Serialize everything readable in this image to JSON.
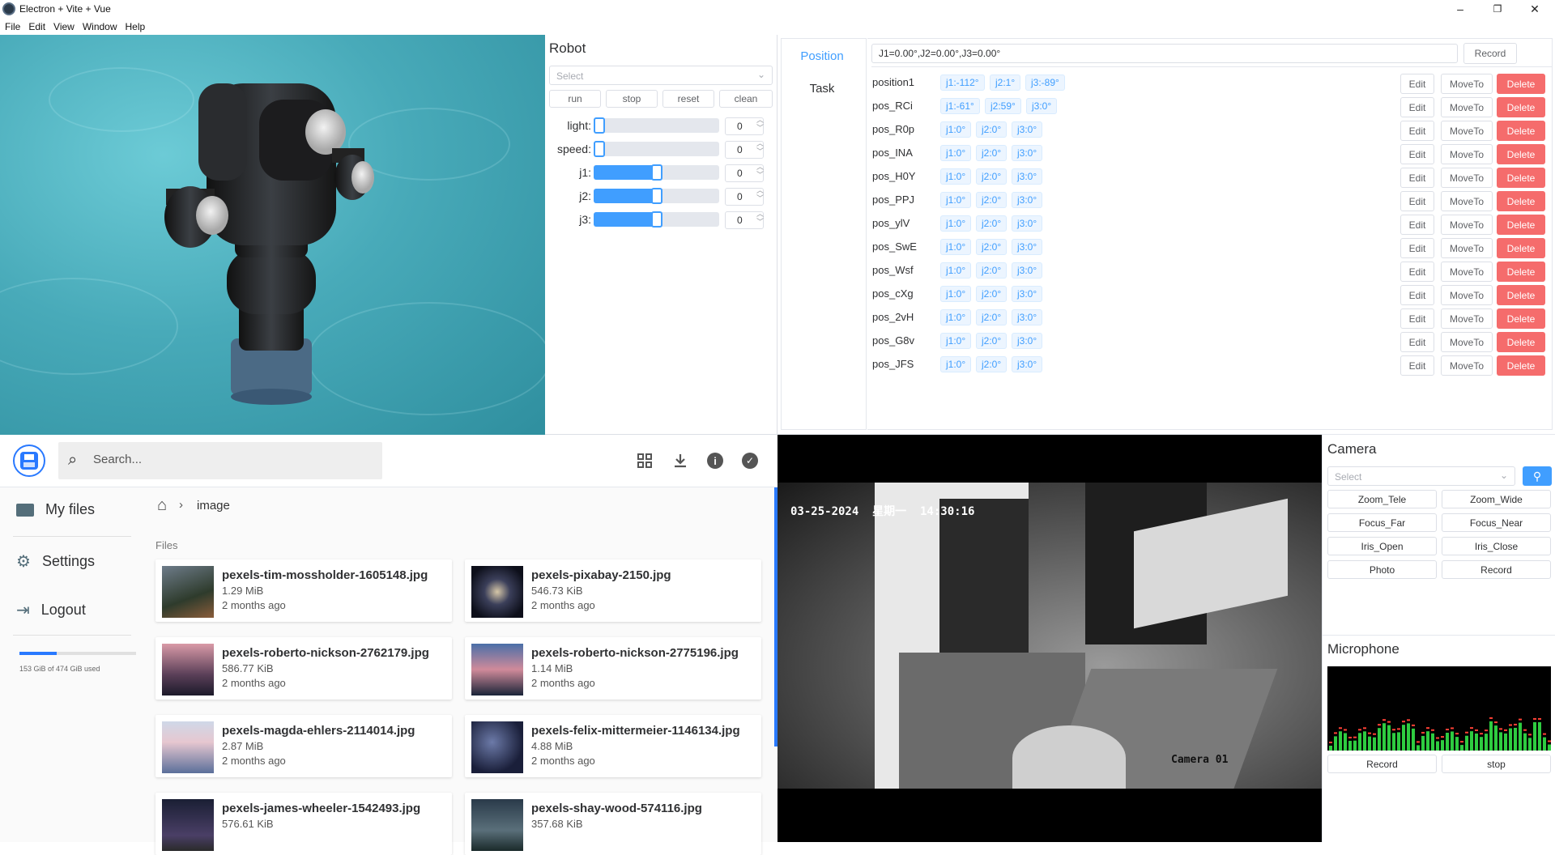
{
  "window": {
    "title": "Electron + Vite + Vue",
    "minimize": "–",
    "maximize": "❐",
    "close": "✕"
  },
  "menu": [
    "File",
    "Edit",
    "View",
    "Window",
    "Help"
  ],
  "robot": {
    "title": "Robot",
    "select_placeholder": "Select",
    "buttons": [
      "run",
      "stop",
      "reset",
      "clean"
    ],
    "sliders": [
      {
        "label": "light:",
        "value": "0",
        "level": 0
      },
      {
        "label": "speed:",
        "value": "0",
        "level": 0
      },
      {
        "label": "j1:",
        "value": "0",
        "level": 0.5
      },
      {
        "label": "j2:",
        "value": "0",
        "level": 0.5
      },
      {
        "label": "j3:",
        "value": "0",
        "level": 0.5
      }
    ]
  },
  "positions": {
    "tabs": [
      "Position",
      "Task"
    ],
    "active_tab": "Position",
    "current": "J1=0.00°,J2=0.00°,J3=0.00°",
    "record_label": "Record",
    "actions": {
      "edit": "Edit",
      "move": "MoveTo",
      "delete": "Delete"
    },
    "rows": [
      {
        "name": "position1",
        "tags": [
          "j1:-112°",
          "j2:1°",
          "j3:-89°"
        ]
      },
      {
        "name": "pos_RCi",
        "tags": [
          "j1:-61°",
          "j2:59°",
          "j3:0°"
        ]
      },
      {
        "name": "pos_R0p",
        "tags": [
          "j1:0°",
          "j2:0°",
          "j3:0°"
        ]
      },
      {
        "name": "pos_INA",
        "tags": [
          "j1:0°",
          "j2:0°",
          "j3:0°"
        ]
      },
      {
        "name": "pos_H0Y",
        "tags": [
          "j1:0°",
          "j2:0°",
          "j3:0°"
        ]
      },
      {
        "name": "pos_PPJ",
        "tags": [
          "j1:0°",
          "j2:0°",
          "j3:0°"
        ]
      },
      {
        "name": "pos_ylV",
        "tags": [
          "j1:0°",
          "j2:0°",
          "j3:0°"
        ]
      },
      {
        "name": "pos_SwE",
        "tags": [
          "j1:0°",
          "j2:0°",
          "j3:0°"
        ]
      },
      {
        "name": "pos_Wsf",
        "tags": [
          "j1:0°",
          "j2:0°",
          "j3:0°"
        ]
      },
      {
        "name": "pos_cXg",
        "tags": [
          "j1:0°",
          "j2:0°",
          "j3:0°"
        ]
      },
      {
        "name": "pos_2vH",
        "tags": [
          "j1:0°",
          "j2:0°",
          "j3:0°"
        ]
      },
      {
        "name": "pos_G8v",
        "tags": [
          "j1:0°",
          "j2:0°",
          "j3:0°"
        ]
      },
      {
        "name": "pos_JFS",
        "tags": [
          "j1:0°",
          "j2:0°",
          "j3:0°"
        ]
      }
    ]
  },
  "files": {
    "search_placeholder": "Search...",
    "nav": [
      "My files",
      "Settings",
      "Logout"
    ],
    "storage_text": "153 GiB of 474 GiB used",
    "storage_fraction": 0.32,
    "breadcrumb": "image",
    "section": "Files",
    "items": [
      {
        "name": "pexels-tim-mossholder-1605148.jpg",
        "size": "1.29 MiB",
        "age": "2 months ago"
      },
      {
        "name": "pexels-pixabay-2150.jpg",
        "size": "546.73 KiB",
        "age": "2 months ago"
      },
      {
        "name": "pexels-roberto-nickson-2762179.jpg",
        "size": "586.77 KiB",
        "age": "2 months ago"
      },
      {
        "name": "pexels-roberto-nickson-2775196.jpg",
        "size": "1.14 MiB",
        "age": "2 months ago"
      },
      {
        "name": "pexels-magda-ehlers-2114014.jpg",
        "size": "2.87 MiB",
        "age": "2 months ago"
      },
      {
        "name": "pexels-felix-mittermeier-1146134.jpg",
        "size": "4.88 MiB",
        "age": "2 months ago"
      },
      {
        "name": "pexels-james-wheeler-1542493.jpg",
        "size": "576.61 KiB",
        "age": ""
      },
      {
        "name": "pexels-shay-wood-574116.jpg",
        "size": "357.68 KiB",
        "age": ""
      }
    ]
  },
  "camera_feed": {
    "timestamp": "03-25-2024  星期一  14:30:16",
    "label": "Camera 01"
  },
  "camera": {
    "title": "Camera",
    "select_placeholder": "Select",
    "buttons": [
      "Zoom_Tele",
      "Zoom_Wide",
      "Focus_Far",
      "Focus_Near",
      "Iris_Open",
      "Iris_Close",
      "Photo",
      "Record"
    ]
  },
  "microphone": {
    "title": "Microphone",
    "buttons": [
      "Record",
      "stop"
    ]
  }
}
